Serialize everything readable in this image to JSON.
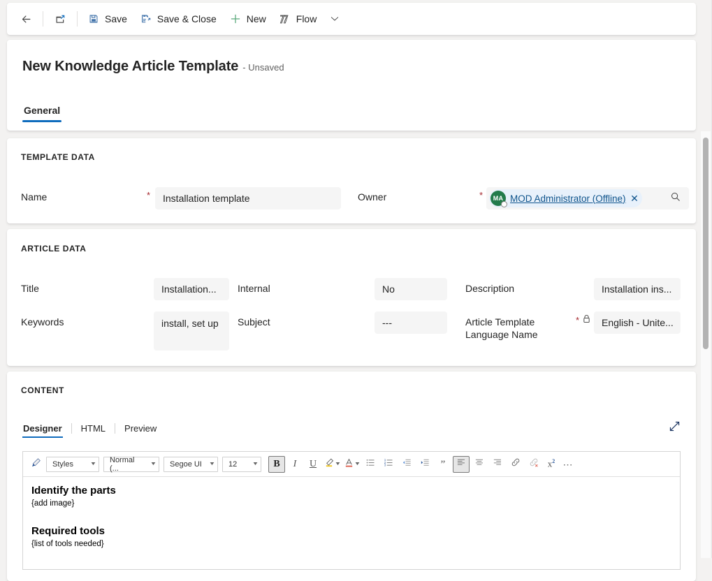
{
  "commandbar": {
    "back": {
      "name": "Back",
      "icon": "arrow-left-icon"
    },
    "popout": {
      "name": "Open in new window",
      "icon": "pop-out-icon"
    },
    "save": {
      "label": "Save",
      "icon": "save-icon"
    },
    "save_close": {
      "label": "Save & Close",
      "icon": "save-close-icon"
    },
    "new": {
      "label": "New",
      "icon": "plus-icon"
    },
    "flow": {
      "label": "Flow",
      "icon": "flow-icon"
    },
    "overflow_caret": "chevron-down-icon"
  },
  "header": {
    "title": "New Knowledge Article Template",
    "state": "- Unsaved",
    "tabs": [
      {
        "label": "General",
        "active": true
      }
    ]
  },
  "template_data": {
    "section_title": "TEMPLATE DATA",
    "fields": {
      "name": {
        "label": "Name",
        "required": true,
        "value": "Installation template"
      },
      "owner": {
        "label": "Owner",
        "required": true,
        "chip_initials": "MA",
        "chip_text": "MOD Administrator (Offline)",
        "chip_remove_icon": "close-icon",
        "search_icon": "search-icon",
        "avatar_color": "#237b4b",
        "chip_bg": "#e8f1fb",
        "chip_text_color": "#0f548c"
      }
    }
  },
  "article_data": {
    "section_title": "ARTICLE DATA",
    "fields": {
      "title": {
        "label": "Title",
        "value": "Installation..."
      },
      "internal": {
        "label": "Internal",
        "value": "No"
      },
      "description": {
        "label": "Description",
        "value": "Installation ins..."
      },
      "keywords": {
        "label": "Keywords",
        "value": "install, set up"
      },
      "subject": {
        "label": "Subject",
        "value": "---"
      },
      "language": {
        "label": "Article Template Language Name",
        "required": true,
        "locked": true,
        "lock_icon": "lock-icon",
        "value": "English - Unite..."
      }
    }
  },
  "content": {
    "section_title": "CONTENT",
    "tabs": [
      {
        "label": "Designer",
        "active": true
      },
      {
        "label": "HTML",
        "active": false
      },
      {
        "label": "Preview",
        "active": false
      }
    ],
    "expand_icon": "expand-diagonal-icon",
    "toolbar": {
      "format_painter": {
        "icon": "format-painter-icon",
        "label": ""
      },
      "styles": {
        "label": "Styles",
        "caret": "chevron-down-icon"
      },
      "paragraph_format": {
        "label": "Normal (...",
        "caret": "chevron-down-icon"
      },
      "font_family": {
        "label": "Segoe UI",
        "caret": "chevron-down-icon"
      },
      "font_size": {
        "label": "12",
        "caret": "chevron-down-icon"
      },
      "bold": {
        "label": "B",
        "icon": "bold-icon",
        "pressed": true
      },
      "italic": {
        "label": "I",
        "icon": "italic-icon",
        "pressed": false
      },
      "underline": {
        "label": "U",
        "icon": "underline-icon",
        "pressed": false
      },
      "highlight": {
        "icon": "text-highlight-icon",
        "caret": "chevron-down-icon"
      },
      "font_color": {
        "icon": "font-color-icon",
        "caret": "chevron-down-icon"
      },
      "bulleted_list": {
        "icon": "bulleted-list-icon"
      },
      "numbered_list": {
        "icon": "numbered-list-icon"
      },
      "decrease_indent": {
        "icon": "decrease-indent-icon"
      },
      "increase_indent": {
        "icon": "increase-indent-icon"
      },
      "blockquote": {
        "icon": "blockquote-icon"
      },
      "align_left": {
        "icon": "align-left-icon",
        "pressed": true
      },
      "align_center": {
        "icon": "align-center-icon"
      },
      "align_right": {
        "icon": "align-right-icon"
      },
      "insert_link": {
        "icon": "link-icon"
      },
      "remove_link": {
        "icon": "unlink-icon"
      },
      "superscript": {
        "icon": "superscript-icon"
      },
      "more": {
        "icon": "ellipsis-icon"
      }
    },
    "body": [
      {
        "type": "heading",
        "text": "Identify the parts"
      },
      {
        "type": "paragraph",
        "text": "{add image}"
      },
      {
        "type": "spacer",
        "text": ""
      },
      {
        "type": "heading",
        "text": "Required tools"
      },
      {
        "type": "paragraph",
        "text": "{list of tools needed}"
      }
    ]
  },
  "scrollbar": {
    "name": "vertical-scrollbar"
  }
}
